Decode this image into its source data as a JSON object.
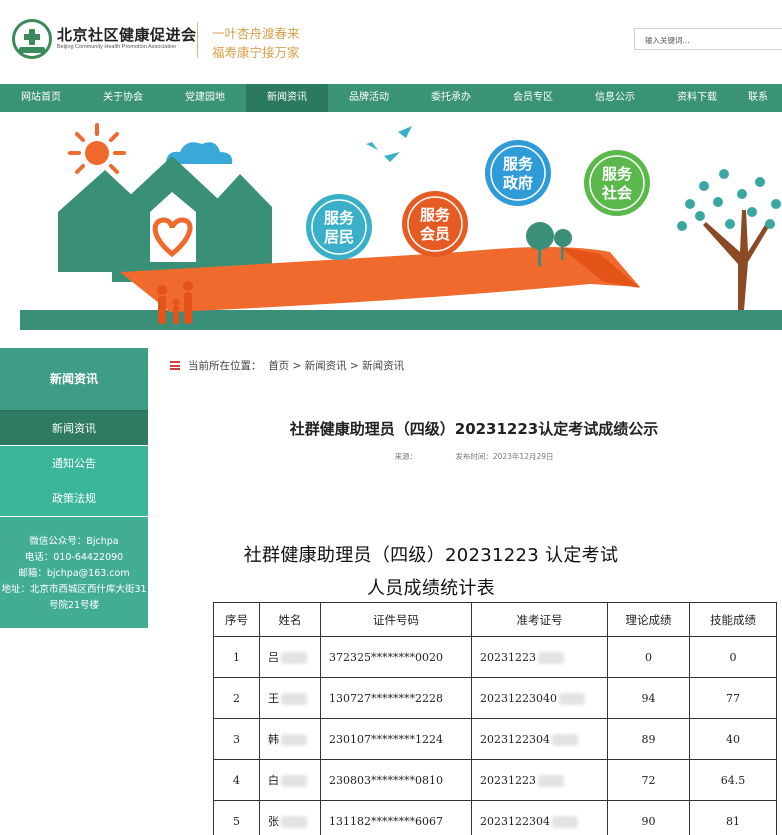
{
  "header": {
    "org_name": "北京社区健康促进会",
    "org_name_en": "Beijing Community Health Promotion Association",
    "slogan_line1": "一叶杏舟渡春来",
    "slogan_line2": "福寿康宁接万家",
    "search_placeholder": "输入关键词..."
  },
  "nav": {
    "items": [
      "网站首页",
      "关于协会",
      "党建园地",
      "新闻资讯",
      "品牌活动",
      "委托承办",
      "会员专区",
      "信息公示",
      "资料下载",
      "联系"
    ],
    "active": "新闻资讯",
    "color": "#3a9277"
  },
  "banner": {
    "badges": [
      {
        "text": "服务\n居民",
        "color": "#3ab0c8"
      },
      {
        "text": "服务\n会员",
        "color": "#e65a23"
      },
      {
        "text": "服务\n政府",
        "color": "#2f9bd8"
      },
      {
        "text": "服务\n社会",
        "color": "#5bb84a"
      }
    ]
  },
  "sidebar": {
    "title": "新闻资讯",
    "items": [
      "新闻资讯",
      "通知公告",
      "政策法规"
    ],
    "contact": {
      "wechat": "微信公众号：Bjchpa",
      "phone": "电话：010-64422090",
      "email": "邮箱：bjchpa@163.com",
      "address_line1": "地址：北京市西城区西什库大街31",
      "address_line2": "号院21号楼"
    }
  },
  "breadcrumb": {
    "label": "当前所在位置：",
    "path": "首页 > 新闻资讯 > 新闻资讯"
  },
  "article": {
    "title": "社群健康助理员（四级）20231223认定考试成绩公示",
    "source_label": "来源：",
    "publish_time": "发布时间：2023年12月29日",
    "doc_title_line1": "社群健康助理员（四级）20231223 认定考试",
    "doc_title_line2": "人员成绩统计表"
  },
  "table": {
    "headers": [
      "序号",
      "姓名",
      "证件号码",
      "准考证号",
      "理论成绩",
      "技能成绩"
    ],
    "rows": [
      {
        "no": "1",
        "name": "吕",
        "id": "372325********0020",
        "ticket": "20231223",
        "theory": "0",
        "skill": "0"
      },
      {
        "no": "2",
        "name": "王",
        "id": "130727********2228",
        "ticket": "20231223040",
        "theory": "94",
        "skill": "77"
      },
      {
        "no": "3",
        "name": "韩",
        "id": "230107********1224",
        "ticket": "2023122304",
        "theory": "89",
        "skill": "40"
      },
      {
        "no": "4",
        "name": "白",
        "id": "230803********0810",
        "ticket": "20231223",
        "theory": "72",
        "skill": "64.5"
      },
      {
        "no": "5",
        "name": "张",
        "id": "131182********6067",
        "ticket": "2023122304",
        "theory": "90",
        "skill": "81"
      }
    ]
  }
}
